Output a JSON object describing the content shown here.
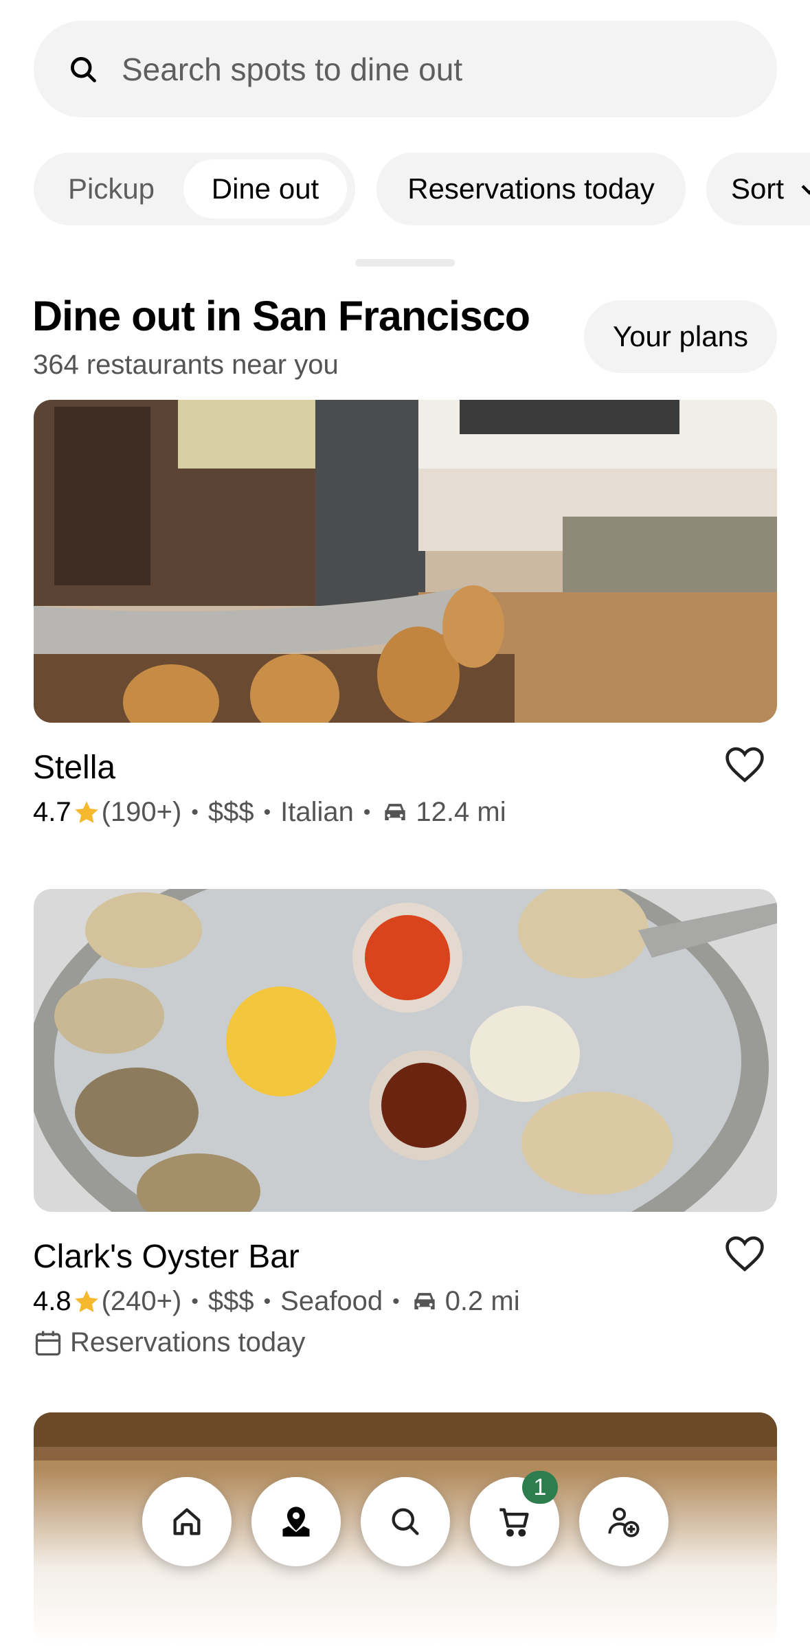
{
  "search": {
    "placeholder": "Search spots to dine out"
  },
  "filters": {
    "mode_options": [
      "Pickup",
      "Dine out"
    ],
    "selected_mode": "Dine out",
    "chips": [
      "Reservations today",
      "Sort"
    ]
  },
  "section": {
    "title": "Dine out in San Francisco",
    "subtitle": "364 restaurants near you",
    "plans_button": "Your plans"
  },
  "restaurants": [
    {
      "name": "Stella",
      "rating": "4.7",
      "reviews": "(190+)",
      "price": "$$$",
      "cuisine": "Italian",
      "distance": "12.4 mi",
      "image_desc": "restaurant interior with marble bar and leather stools"
    },
    {
      "name": "Clark's Oyster Bar",
      "rating": "4.8",
      "reviews": "(240+)",
      "price": "$$$",
      "cuisine": "Seafood",
      "distance": "0.2 mi",
      "reservation_note": "Reservations today",
      "image_desc": "oysters on ice with lemon and sauces"
    }
  ],
  "bottom_nav": {
    "items": [
      "home-icon",
      "explore-pin-icon",
      "search-icon",
      "cart-icon",
      "account-icon"
    ],
    "cart_badge": "1"
  },
  "colors": {
    "star": "#f5b82e",
    "badge": "#2e7d4f",
    "chip_bg": "#f3f3f3"
  }
}
